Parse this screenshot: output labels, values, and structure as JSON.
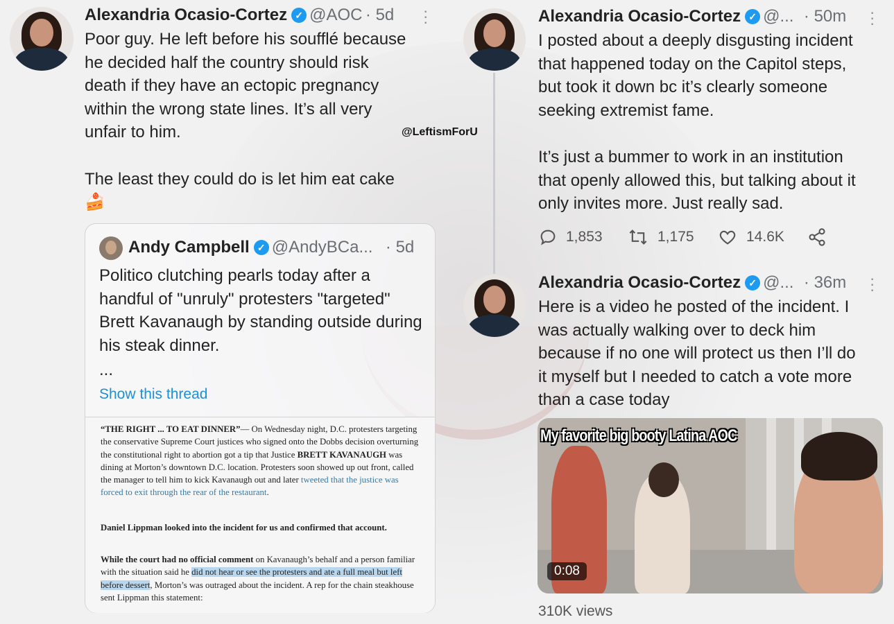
{
  "tweet_left": {
    "author": "Alexandria Ocasio-Cortez",
    "handle": "@AOC",
    "time": "· 5d",
    "body": "Poor guy. He left before his soufflé because\nhe decided half the country should risk\ndeath if they have an ectopic pregnancy\nwithin the wrong state lines. It’s all very\nunfair to him.\n\nThe least they could do is let him eat cake\n🍰",
    "quote": {
      "author": "Andy Campbell",
      "handle": "@AndyBCa...",
      "time": "· 5d",
      "text": "Politico clutching pearls today after a handful of \"unruly\" protesters \"targeted\" Brett Kavanaugh by standing outside during his steak dinner.",
      "ellipsis": "...",
      "show_thread": "Show this thread",
      "article": {
        "p1_lead": "“THE RIGHT ... TO EAT DINNER”",
        "p1_a": "— On Wednesday night, D.C. protesters targeting the conservative Supreme Court justices who signed onto the Dobbs decision overturning the constitutional right to abortion got a tip that Justice ",
        "p1_name": "BRETT KAVANAUGH",
        "p1_b": " was dining at Morton’s downtown D.C. location. Protesters soon showed up out front, called the manager to tell him to kick Kavanaugh out and later ",
        "p1_link": "tweeted that the justice was forced to exit through the rear of the restaurant",
        "p1_end": ".",
        "p2": "Daniel Lippman looked into the incident for us and confirmed that account.",
        "p3_lead": "While the court had no official comment",
        "p3_a": " on Kavanaugh’s behalf and a person familiar with the situation said he ",
        "p3_hl": "did not hear or see the protesters and ate a full meal but left before dessert",
        "p3_b": ", Morton’s was outraged about the incident. A rep for the chain steakhouse sent Lippman this statement:"
      }
    }
  },
  "watermark": "@LeftismForU",
  "tweet_right_1": {
    "author": "Alexandria Ocasio-Cortez",
    "handle": "@...",
    "time": "· 50m",
    "body": "I posted about a deeply disgusting incident\nthat happened today on the Capitol steps,\nbut took it down bc it’s clearly someone\nseeking extremist fame.\n\nIt’s just a bummer to work in an institution\nthat openly allowed this, but talking about it\nonly invites more. Just really sad.",
    "replies": "1,853",
    "retweets": "1,175",
    "likes": "14.6K"
  },
  "tweet_right_2": {
    "author": "Alexandria Ocasio-Cortez",
    "handle": "@...",
    "time": "· 36m",
    "body": "Here is a video he posted of the incident. I\nwas actually walking over to deck him\nbecause if no one will protect us then I’ll do\nit myself but I needed to catch a vote more\nthan a case today",
    "video_caption": "My favorite big booty Latina AOC",
    "video_time": "0:08",
    "views": "310K views"
  },
  "colors": {
    "verified": "#1d9bf0",
    "link": "#1d8fd8",
    "highlight": "#b8d7ef"
  }
}
